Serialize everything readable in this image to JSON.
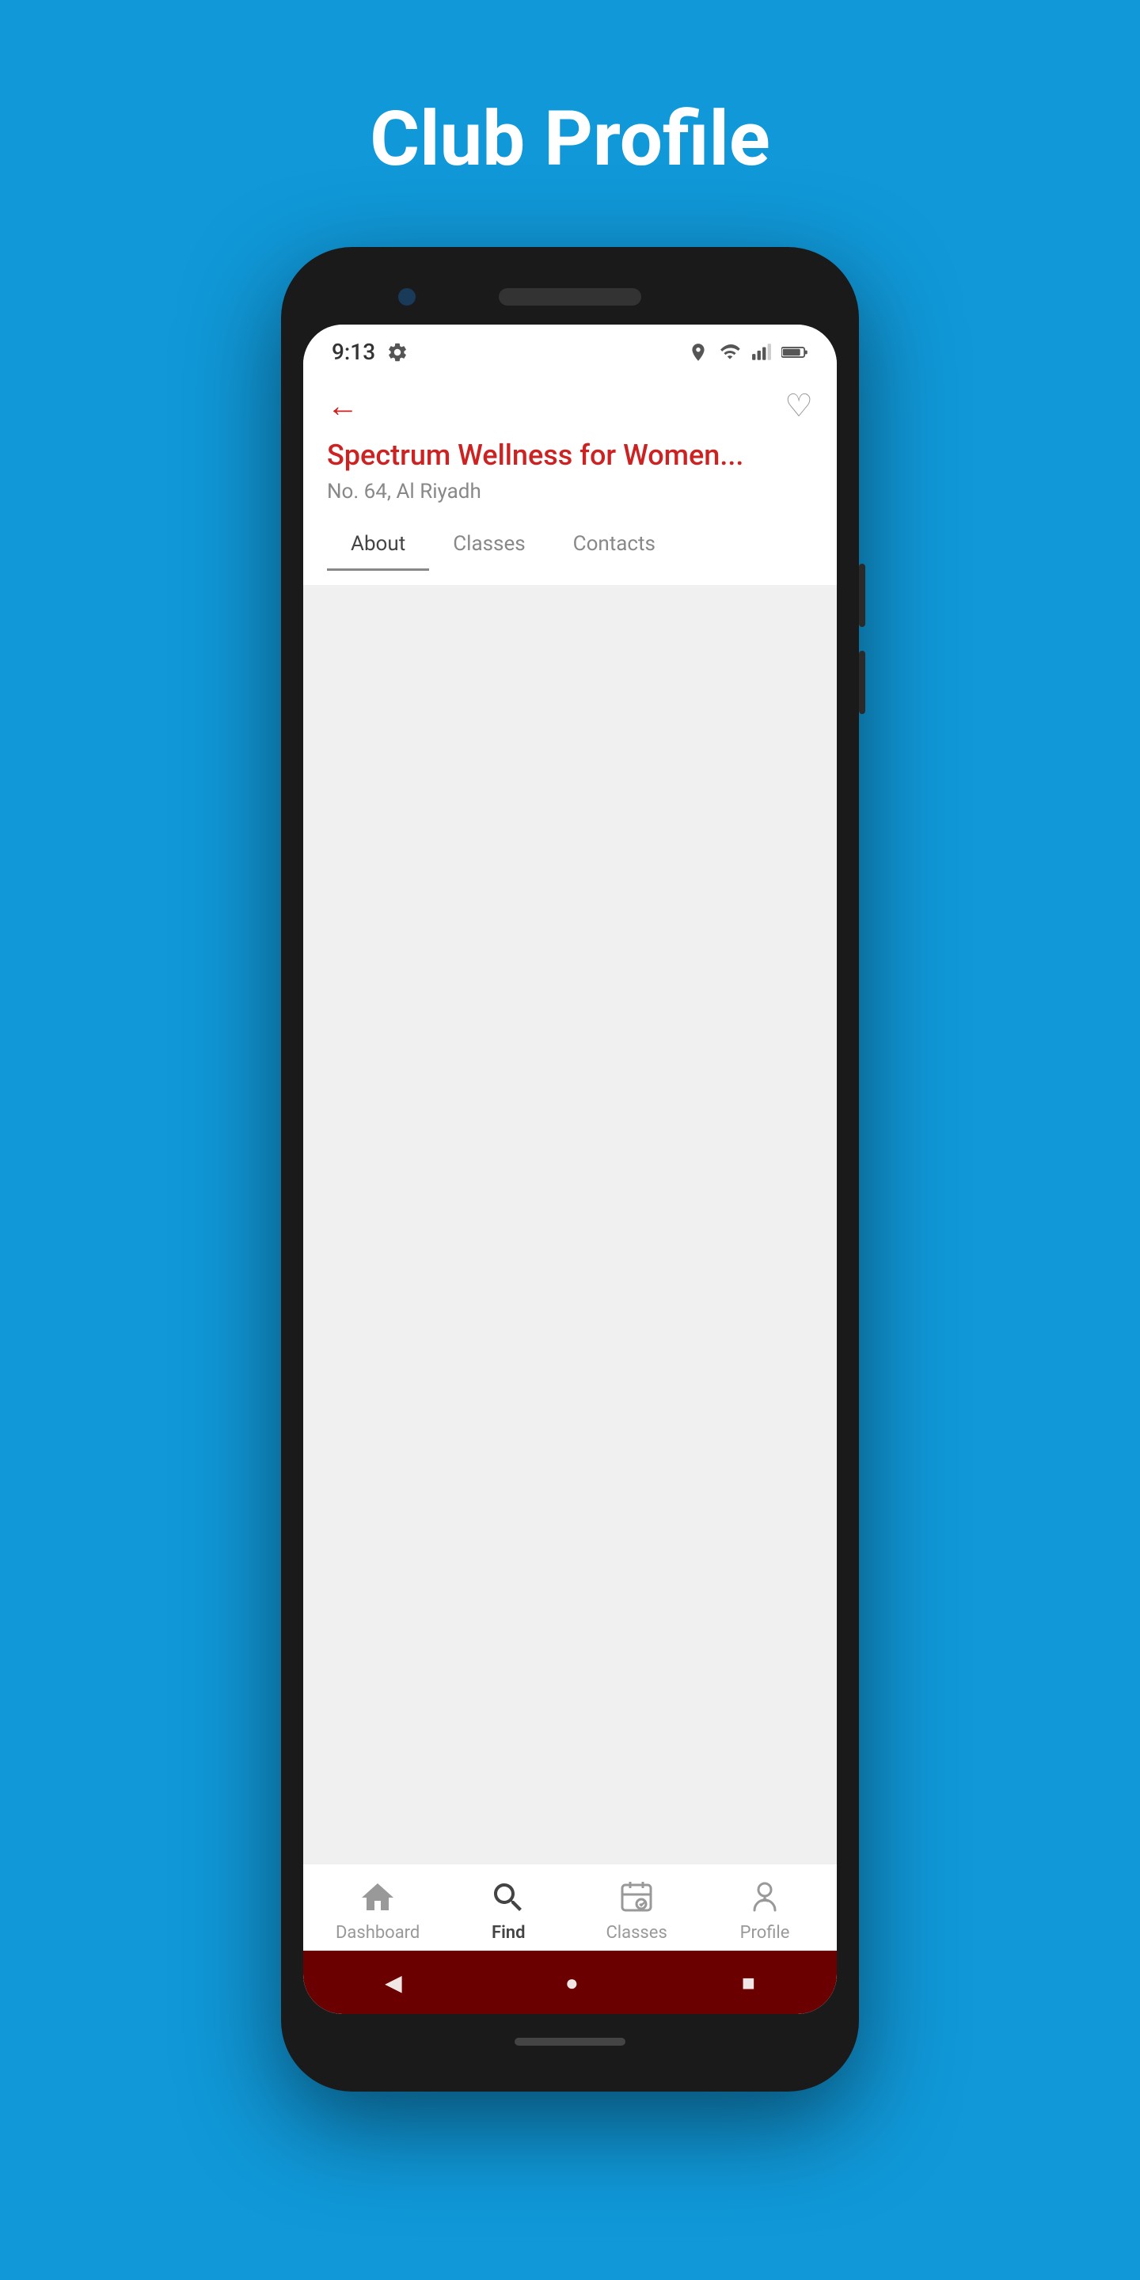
{
  "page": {
    "title": "Club Profile",
    "background_color": "#1098D8"
  },
  "status_bar": {
    "time": "9:13",
    "icons": [
      "settings-icon",
      "location-icon",
      "wifi-icon",
      "signal-icon",
      "battery-icon"
    ]
  },
  "header": {
    "back_label": "←",
    "heart_label": "♡",
    "club_name": "Spectrum Wellness for Women...",
    "club_address": "No. 64, Al Riyadh"
  },
  "tabs": [
    {
      "label": "About",
      "active": true
    },
    {
      "label": "Classes",
      "active": false
    },
    {
      "label": "Contacts",
      "active": false
    }
  ],
  "bottom_nav": [
    {
      "label": "Dashboard",
      "icon": "home-icon",
      "active": false
    },
    {
      "label": "Find",
      "icon": "search-icon",
      "active": true
    },
    {
      "label": "Classes",
      "icon": "classes-icon",
      "active": false
    },
    {
      "label": "Profile",
      "icon": "profile-icon",
      "active": false
    }
  ],
  "android_nav": {
    "back": "◀",
    "home": "●",
    "recent": "■"
  }
}
